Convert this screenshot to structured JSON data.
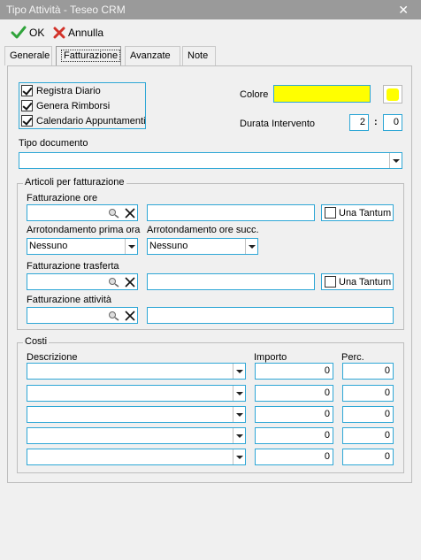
{
  "window": {
    "title": "Tipo Attività - Teseo CRM",
    "close_glyph": "✕"
  },
  "toolbar": {
    "ok_label": "OK",
    "cancel_label": "Annulla"
  },
  "tabs": [
    {
      "label": "Generale",
      "active": false
    },
    {
      "label": "Fatturazione",
      "active": true
    },
    {
      "label": "Avanzate",
      "active": false
    },
    {
      "label": "Note",
      "active": false
    }
  ],
  "options": {
    "registra_diario": {
      "label": "Registra Diario",
      "checked": true
    },
    "genera_rimborsi": {
      "label": "Genera Rimborsi",
      "checked": true
    },
    "calendario": {
      "label": "Calendario Appuntamenti",
      "checked": true
    }
  },
  "colore": {
    "label": "Colore",
    "value_color": "#ffff00"
  },
  "durata": {
    "label": "Durata Intervento",
    "hours": "2",
    "separator": ":",
    "minutes": "0"
  },
  "tipo_documento": {
    "label": "Tipo documento",
    "value": ""
  },
  "articoli": {
    "legend": "Articoli per fatturazione",
    "fatturazione_ore": {
      "label": "Fatturazione ore",
      "code": "",
      "description": "",
      "una_tantum_label": "Una Tantum",
      "una_tantum_checked": false
    },
    "arrotondamento_prima": {
      "label": "Arrotondamento prima ora",
      "value": "Nessuno"
    },
    "arrotondamento_succ": {
      "label": "Arrotondamento ore succ.",
      "value": "Nessuno"
    },
    "fatturazione_trasferta": {
      "label": "Fatturazione trasferta",
      "code": "",
      "description": "",
      "una_tantum_label": "Una Tantum",
      "una_tantum_checked": false
    },
    "fatturazione_attivita": {
      "label": "Fatturazione attività",
      "code": "",
      "description": ""
    }
  },
  "costi": {
    "legend": "Costi",
    "headers": {
      "descrizione": "Descrizione",
      "importo": "Importo",
      "perc": "Perc."
    },
    "rows": [
      {
        "descrizione": "",
        "importo": "0",
        "perc": "0"
      },
      {
        "descrizione": "",
        "importo": "0",
        "perc": "0"
      },
      {
        "descrizione": "",
        "importo": "0",
        "perc": "0"
      },
      {
        "descrizione": "",
        "importo": "0",
        "perc": "0"
      },
      {
        "descrizione": "",
        "importo": "0",
        "perc": "0"
      }
    ]
  }
}
